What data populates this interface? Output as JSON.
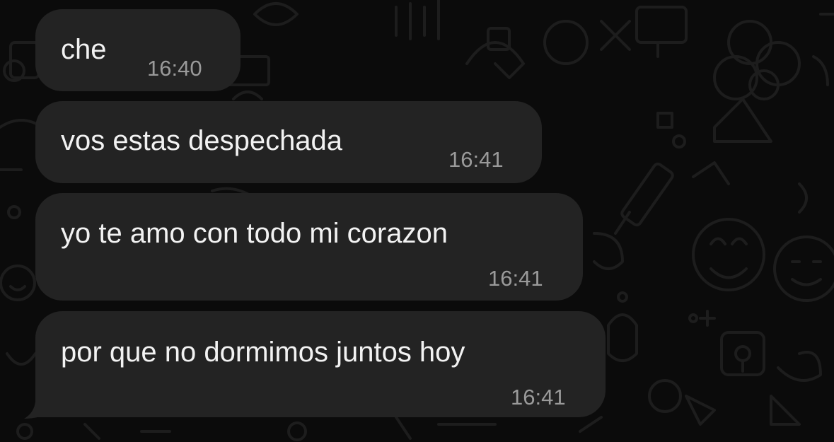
{
  "messages": [
    {
      "text": "che",
      "time": "16:40"
    },
    {
      "text": "vos estas despechada",
      "time": "16:41"
    },
    {
      "text": "yo te amo con todo mi corazon",
      "time": "16:41"
    },
    {
      "text": "por que no dormimos juntos hoy",
      "time": "16:41"
    }
  ],
  "colors": {
    "background": "#0b0b0b",
    "bubble": "#232323",
    "message_text": "#f2f2f2",
    "timestamp": "#9a9a9a",
    "doodle": "#1c1c1c"
  }
}
